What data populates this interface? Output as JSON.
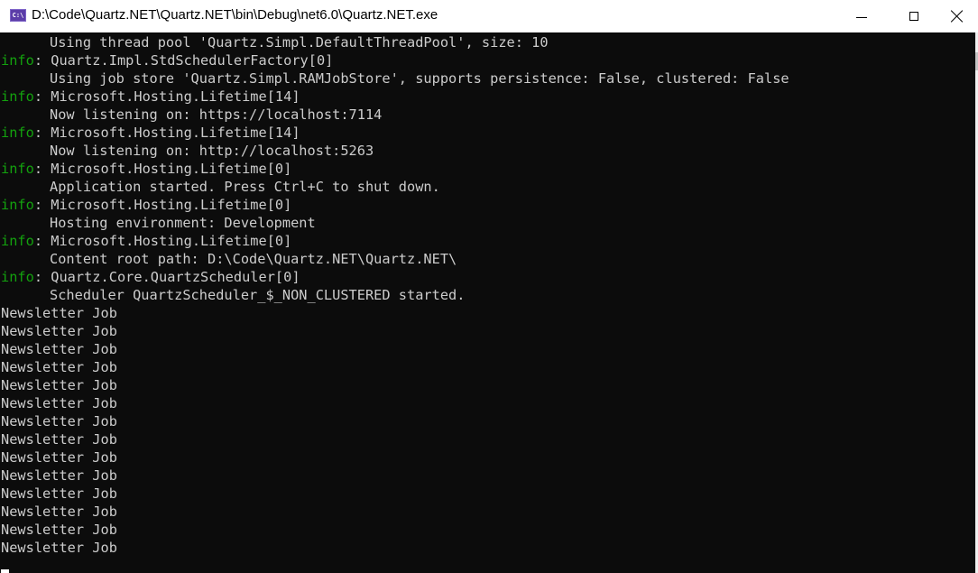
{
  "window": {
    "title": "D:\\Code\\Quartz.NET\\Quartz.NET\\bin\\Debug\\net6.0\\Quartz.NET.exe",
    "app_icon": "console-app-icon",
    "app_icon_text": "C:\\",
    "controls": {
      "minimize": "minimize-icon",
      "maximize": "maximize-icon",
      "close": "close-icon"
    }
  },
  "console": {
    "colors": {
      "background": "#0c0c0c",
      "text": "#cccccc",
      "info_level": "#13a10e"
    },
    "lines": [
      {
        "level": "",
        "text": "Using thread pool 'Quartz.Simpl.DefaultThreadPool', size: 10",
        "indent": true
      },
      {
        "level": "info",
        "text": ": Quartz.Impl.StdSchedulerFactory[0]",
        "indent": false
      },
      {
        "level": "",
        "text": "Using job store 'Quartz.Simpl.RAMJobStore', supports persistence: False, clustered: False",
        "indent": true
      },
      {
        "level": "info",
        "text": ": Microsoft.Hosting.Lifetime[14]",
        "indent": false
      },
      {
        "level": "",
        "text": "Now listening on: https://localhost:7114",
        "indent": true
      },
      {
        "level": "info",
        "text": ": Microsoft.Hosting.Lifetime[14]",
        "indent": false
      },
      {
        "level": "",
        "text": "Now listening on: http://localhost:5263",
        "indent": true
      },
      {
        "level": "info",
        "text": ": Microsoft.Hosting.Lifetime[0]",
        "indent": false
      },
      {
        "level": "",
        "text": "Application started. Press Ctrl+C to shut down.",
        "indent": true
      },
      {
        "level": "info",
        "text": ": Microsoft.Hosting.Lifetime[0]",
        "indent": false
      },
      {
        "level": "",
        "text": "Hosting environment: Development",
        "indent": true
      },
      {
        "level": "info",
        "text": ": Microsoft.Hosting.Lifetime[0]",
        "indent": false
      },
      {
        "level": "",
        "text": "Content root path: D:\\Code\\Quartz.NET\\Quartz.NET\\",
        "indent": true
      },
      {
        "level": "info",
        "text": ": Quartz.Core.QuartzScheduler[0]",
        "indent": false
      },
      {
        "level": "",
        "text": "Scheduler QuartzScheduler_$_NON_CLUSTERED started.",
        "indent": true
      },
      {
        "level": "",
        "text": "Newsletter Job",
        "indent": false
      },
      {
        "level": "",
        "text": "Newsletter Job",
        "indent": false
      },
      {
        "level": "",
        "text": "Newsletter Job",
        "indent": false
      },
      {
        "level": "",
        "text": "Newsletter Job",
        "indent": false
      },
      {
        "level": "",
        "text": "Newsletter Job",
        "indent": false
      },
      {
        "level": "",
        "text": "Newsletter Job",
        "indent": false
      },
      {
        "level": "",
        "text": "Newsletter Job",
        "indent": false
      },
      {
        "level": "",
        "text": "Newsletter Job",
        "indent": false
      },
      {
        "level": "",
        "text": "Newsletter Job",
        "indent": false
      },
      {
        "level": "",
        "text": "Newsletter Job",
        "indent": false
      },
      {
        "level": "",
        "text": "Newsletter Job",
        "indent": false
      },
      {
        "level": "",
        "text": "Newsletter Job",
        "indent": false
      },
      {
        "level": "",
        "text": "Newsletter Job",
        "indent": false
      },
      {
        "level": "",
        "text": "Newsletter Job",
        "indent": false
      }
    ]
  }
}
